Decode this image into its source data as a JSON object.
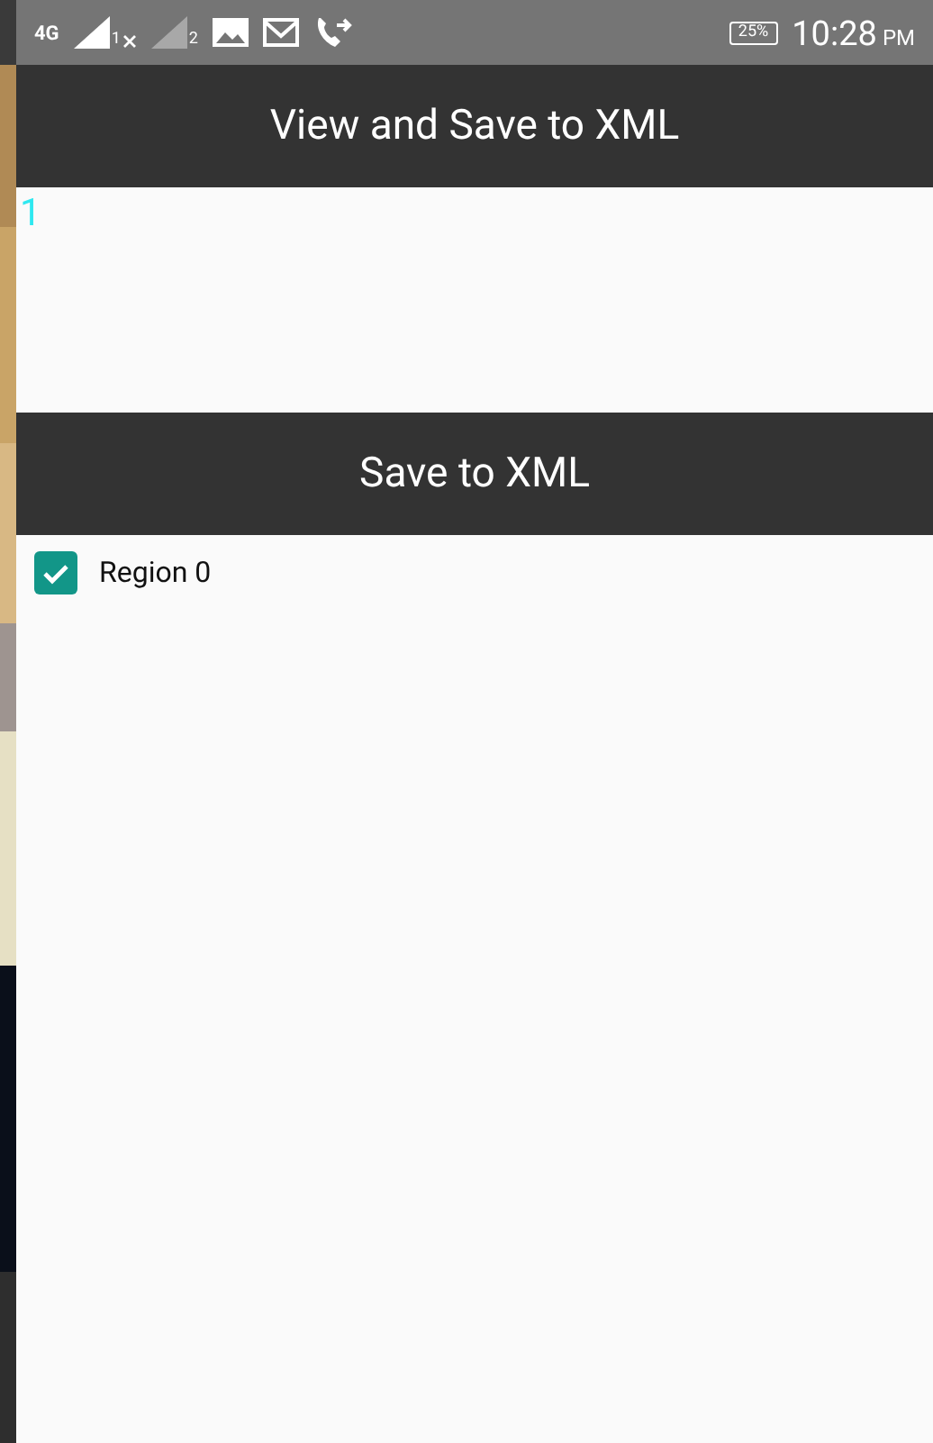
{
  "status_bar": {
    "network_type": "4G",
    "sims": [
      {
        "label": "1",
        "has_signal": true
      },
      {
        "label": "2",
        "has_signal": false
      }
    ],
    "battery": "25%",
    "time": "10:28",
    "meridiem": "PM"
  },
  "app_bar": {
    "title": "View and Save to XML"
  },
  "content": {
    "count": "1"
  },
  "save_button": {
    "label": "Save to XML"
  },
  "regions": [
    {
      "label": "Region 0",
      "checked": true
    }
  ]
}
